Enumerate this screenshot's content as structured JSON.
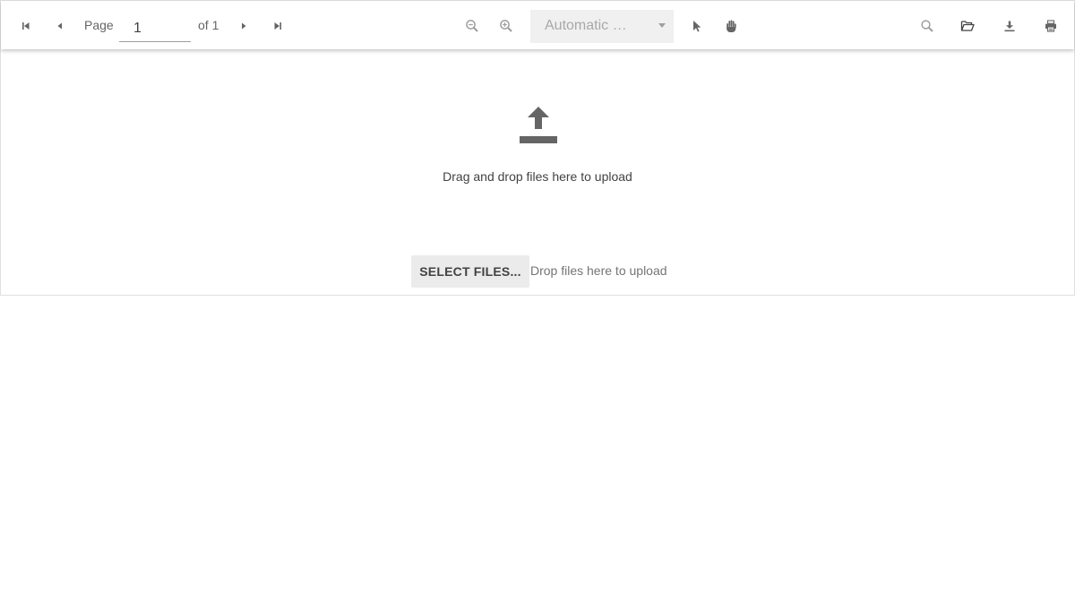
{
  "toolbar": {
    "buttons": {
      "first_page": {
        "icon": "first-page-icon"
      },
      "previous_page": {
        "icon": "previous-page-icon"
      },
      "next_page": {
        "icon": "next-page-icon"
      },
      "last_page": {
        "icon": "last-page-icon"
      },
      "zoom_out": {
        "icon": "zoom-out-icon"
      },
      "zoom_in": {
        "icon": "zoom-in-icon"
      },
      "text_select": {
        "icon": "cursor-icon"
      },
      "pan": {
        "icon": "hand-icon"
      },
      "search": {
        "icon": "search-icon"
      },
      "open": {
        "icon": "folder-open-icon"
      },
      "download": {
        "icon": "download-icon"
      },
      "print": {
        "icon": "print-icon"
      }
    },
    "page_label": "Page",
    "page_value": "1",
    "page_count": "of 1",
    "zoom": {
      "selected": "Automatic Width"
    }
  },
  "drop_zone": {
    "icon": "upload-icon",
    "title": "Drag and drop files here to upload",
    "select_button_label": "SELECT FILES...",
    "hint": "Drop files here to upload"
  },
  "colors": {
    "icon": "#656565",
    "icon_disabled": "#9e9e9e",
    "select_bg": "#f0f0f0",
    "button_bg": "#ebebeb",
    "text": "#424242",
    "muted_text": "#757575"
  }
}
